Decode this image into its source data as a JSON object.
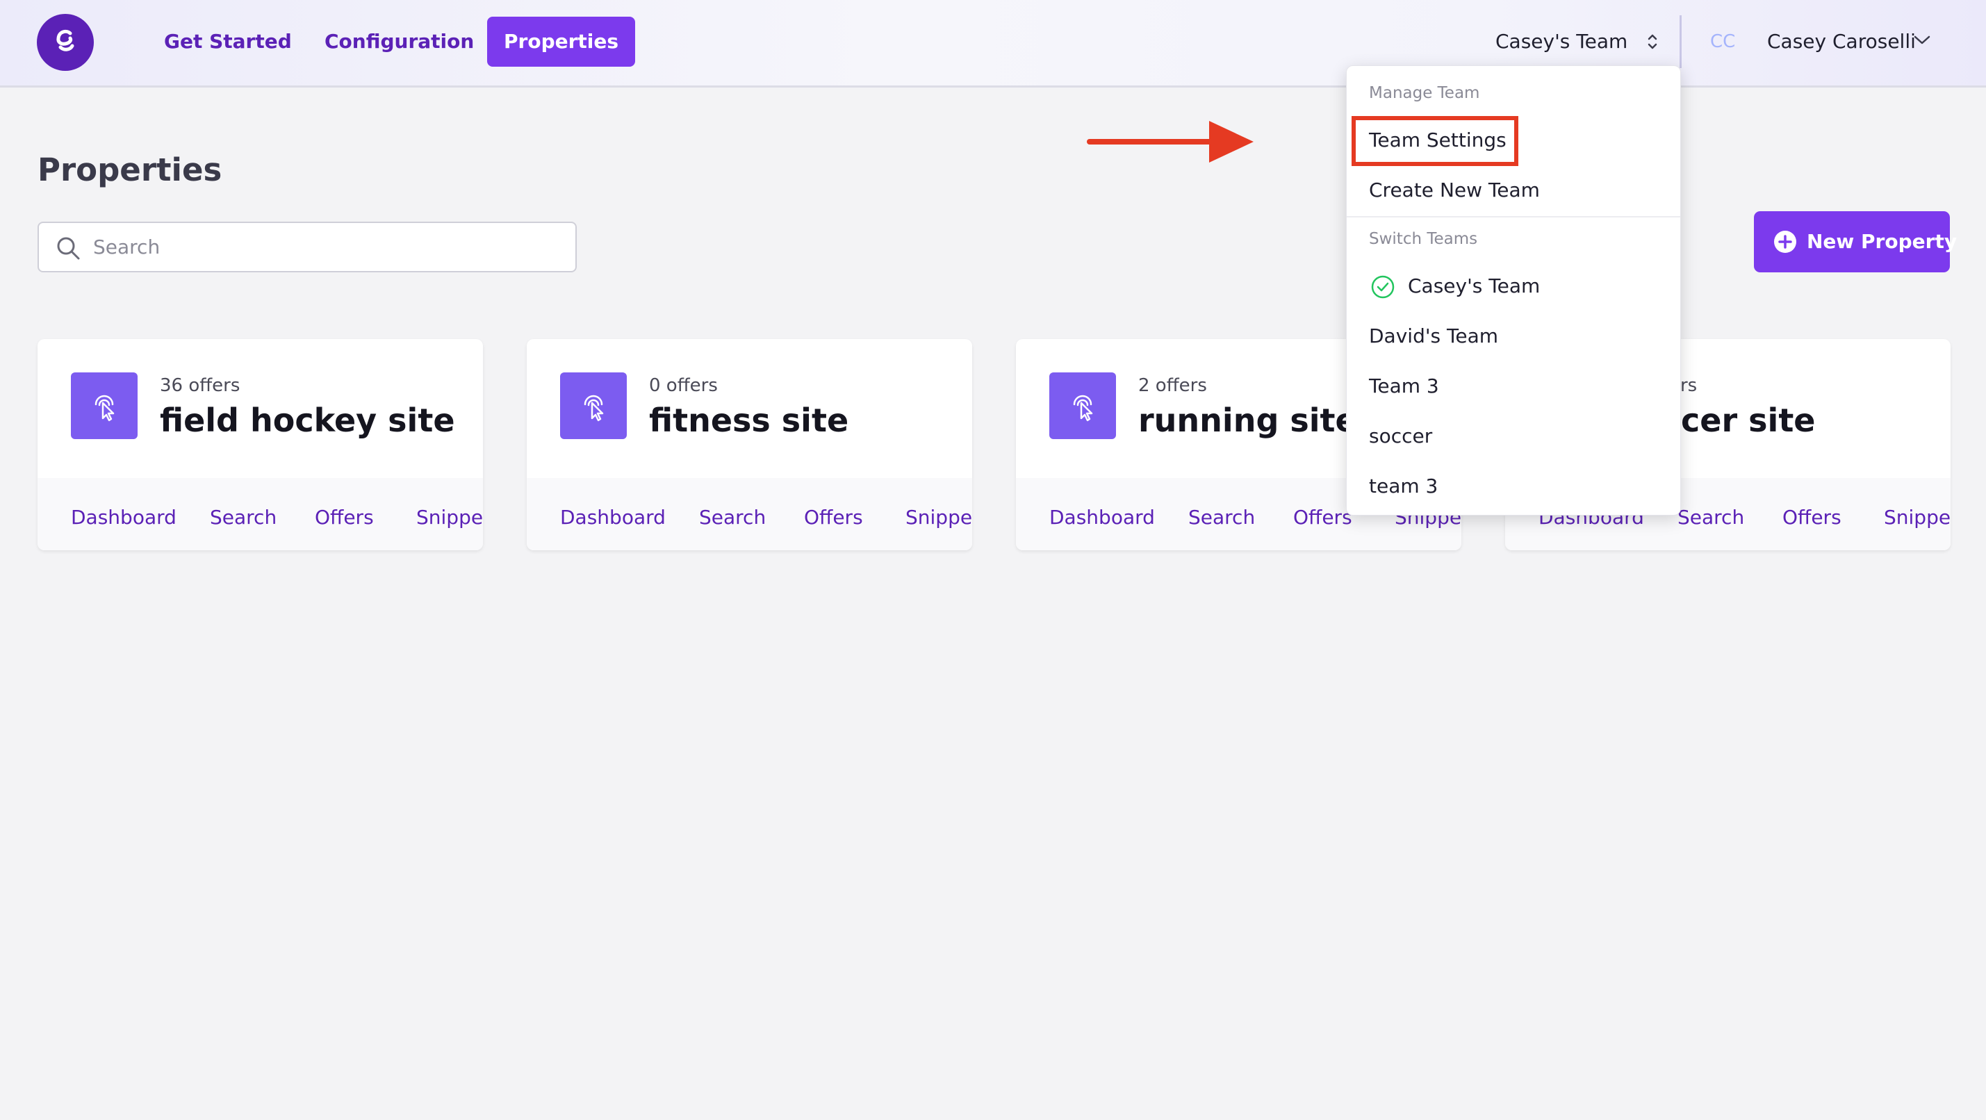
{
  "header": {
    "nav": [
      {
        "label": "Get Started"
      },
      {
        "label": "Configuration"
      },
      {
        "label": "Properties"
      }
    ],
    "team_switcher_label": "Casey's Team",
    "user_initials": "CC",
    "user_name": "Casey Caroselli"
  },
  "page": {
    "title": "Properties",
    "search_placeholder": "Search",
    "new_property_label": "New Property"
  },
  "cards": [
    {
      "offers": "36 offers",
      "title": "field hockey site",
      "links": [
        "Dashboard",
        "Search",
        "Offers",
        "Snippet"
      ]
    },
    {
      "offers": "0 offers",
      "title": "fitness site",
      "links": [
        "Dashboard",
        "Search",
        "Offers",
        "Snippet"
      ]
    },
    {
      "offers": "2 offers",
      "title": "running site",
      "links": [
        "Dashboard",
        "Search",
        "Offers",
        "Snippet"
      ]
    },
    {
      "offers": "ers",
      "title": "cer site",
      "links": [
        "Dashboard",
        "Search",
        "Offers",
        "Snippet"
      ]
    }
  ],
  "dropdown": {
    "manage_heading": "Manage Team",
    "team_settings": "Team Settings",
    "create_new_team": "Create New Team",
    "switch_heading": "Switch Teams",
    "teams": [
      "Casey's Team",
      "David's Team",
      "Team 3",
      "soccer",
      "team 3"
    ],
    "current_team": "Casey's Team"
  },
  "colors": {
    "brand_primary": "#7c3aed",
    "brand_dark": "#5b21b6",
    "annotation_red": "#e53a22",
    "check_green": "#22c55e"
  }
}
